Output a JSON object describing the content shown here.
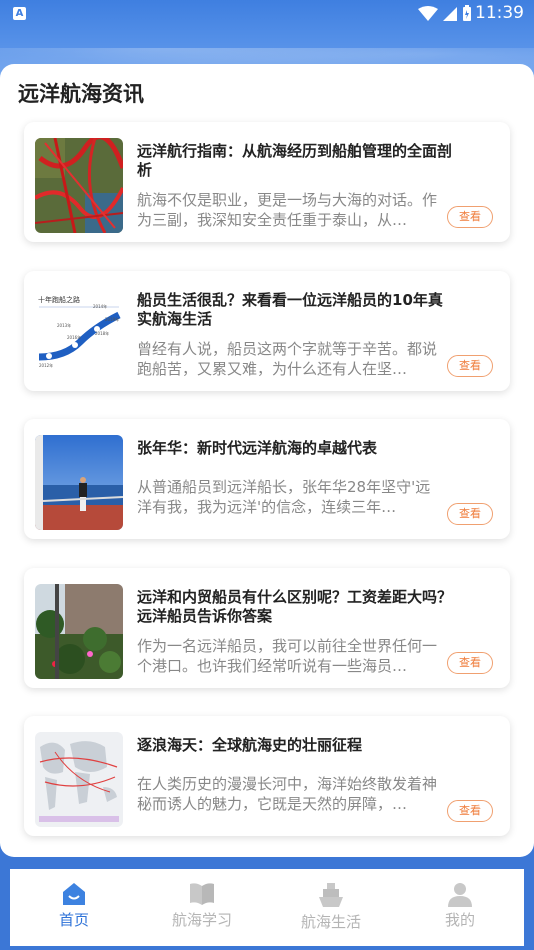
{
  "status_bar": {
    "time": "11:39",
    "left_badge": "A"
  },
  "section": {
    "title": "远洋航海资讯"
  },
  "articles": [
    {
      "title": "远洋航行指南：从航海经历到船舶管理的全面剖析",
      "excerpt": "航海不仅是职业，更是一场与大海的对话。作为三副，我深知安全责任重于泰山，从…",
      "button": "查看"
    },
    {
      "title": "船员生活很乱？来看看一位远洋船员的10年真实航海生活",
      "excerpt": "曾经有人说，船员这两个字就等于辛苦。都说跑船苦，又累又难，为什么还有人在坚…",
      "button": "查看",
      "thumb_text": {
        "heading": "十年跑船之路",
        "years": [
          "2013年",
          "2014年",
          "2016年",
          "2018年",
          "2019年",
          "2012年"
        ]
      }
    },
    {
      "title": "张年华：新时代远洋航海的卓越代表",
      "excerpt": "从普通船员到远洋船长，张年华28年坚守'远洋有我，我为远洋'的信念，连续三年…",
      "button": "查看"
    },
    {
      "title": "远洋和内贸船员有什么区别呢？工资差距大吗？远洋船员告诉你答案",
      "excerpt": "作为一名远洋船员，我可以前往全世界任何一个港口。也许我们经常听说有一些海员…",
      "button": "查看"
    },
    {
      "title": "逐浪海天：全球航海史的壮丽征程",
      "excerpt": "在人类历史的漫漫长河中，海洋始终散发着神秘而诱人的魅力，它既是天然的屏障，…",
      "button": "查看"
    }
  ],
  "tabs": [
    {
      "label": "首页",
      "icon": "home-icon",
      "active": true
    },
    {
      "label": "航海学习",
      "icon": "book-icon",
      "active": false
    },
    {
      "label": "航海生活",
      "icon": "ship-icon",
      "active": false
    },
    {
      "label": "我的",
      "icon": "profile-icon",
      "active": false
    }
  ],
  "colors": {
    "accent": "#2f73d8",
    "button": "#ef7b39",
    "header": "#3f7fe0"
  }
}
